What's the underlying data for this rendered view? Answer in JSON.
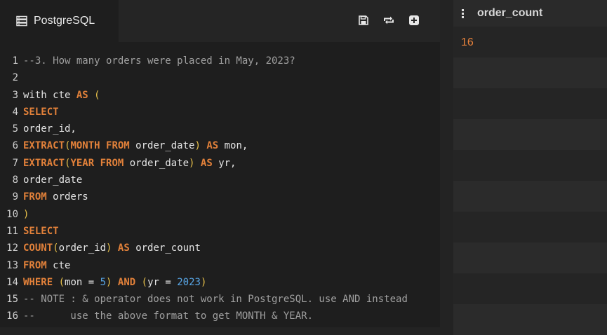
{
  "editor": {
    "tab_label": "PostgreSQL",
    "tab_icon": "database-icon",
    "toolbar": {
      "save_icon": "save-icon",
      "refresh_icon": "refresh-icon",
      "add_icon": "add-icon"
    },
    "lines": [
      {
        "num": "1",
        "tokens": [
          {
            "t": "--3. How many orders were placed in May, 2023?",
            "c": "c"
          }
        ]
      },
      {
        "num": "2",
        "tokens": []
      },
      {
        "num": "3",
        "tokens": [
          {
            "t": "with cte "
          },
          {
            "t": "AS",
            "c": "k"
          },
          {
            "t": " "
          },
          {
            "t": "(",
            "c": "p"
          }
        ]
      },
      {
        "num": "4",
        "tokens": [
          {
            "t": "SELECT",
            "c": "k"
          }
        ]
      },
      {
        "num": "5",
        "tokens": [
          {
            "t": "order_id,"
          }
        ]
      },
      {
        "num": "6",
        "tokens": [
          {
            "t": "EXTRACT",
            "c": "k"
          },
          {
            "t": "(",
            "c": "p"
          },
          {
            "t": "MONTH FROM",
            "c": "k"
          },
          {
            "t": " order_date"
          },
          {
            "t": ")",
            "c": "p"
          },
          {
            "t": " "
          },
          {
            "t": "AS",
            "c": "k"
          },
          {
            "t": " mon,"
          }
        ]
      },
      {
        "num": "7",
        "tokens": [
          {
            "t": "EXTRACT",
            "c": "k"
          },
          {
            "t": "(",
            "c": "p"
          },
          {
            "t": "YEAR FROM",
            "c": "k"
          },
          {
            "t": " order_date"
          },
          {
            "t": ")",
            "c": "p"
          },
          {
            "t": " "
          },
          {
            "t": "AS",
            "c": "k"
          },
          {
            "t": " yr,"
          }
        ]
      },
      {
        "num": "8",
        "tokens": [
          {
            "t": "order_date"
          }
        ]
      },
      {
        "num": "9",
        "tokens": [
          {
            "t": "FROM",
            "c": "k"
          },
          {
            "t": " orders"
          }
        ]
      },
      {
        "num": "10",
        "tokens": [
          {
            "t": ")",
            "c": "p"
          }
        ]
      },
      {
        "num": "11",
        "tokens": [
          {
            "t": "SELECT",
            "c": "k"
          }
        ]
      },
      {
        "num": "12",
        "tokens": [
          {
            "t": "COUNT",
            "c": "k"
          },
          {
            "t": "(",
            "c": "p"
          },
          {
            "t": "order_id"
          },
          {
            "t": ")",
            "c": "p"
          },
          {
            "t": " "
          },
          {
            "t": "AS",
            "c": "k"
          },
          {
            "t": " order_count"
          }
        ]
      },
      {
        "num": "13",
        "tokens": [
          {
            "t": "FROM",
            "c": "k"
          },
          {
            "t": " cte"
          }
        ]
      },
      {
        "num": "14",
        "tokens": [
          {
            "t": "WHERE",
            "c": "k"
          },
          {
            "t": " "
          },
          {
            "t": "(",
            "c": "p"
          },
          {
            "t": "mon = "
          },
          {
            "t": "5",
            "c": "n"
          },
          {
            "t": ")",
            "c": "p"
          },
          {
            "t": " "
          },
          {
            "t": "AND",
            "c": "k"
          },
          {
            "t": " "
          },
          {
            "t": "(",
            "c": "p"
          },
          {
            "t": "yr = "
          },
          {
            "t": "2023",
            "c": "n"
          },
          {
            "t": ")",
            "c": "p"
          }
        ]
      },
      {
        "num": "15",
        "tokens": [
          {
            "t": "-- NOTE : & operator does not work in PostgreSQL. use AND instead",
            "c": "c"
          }
        ]
      },
      {
        "num": "16",
        "tokens": [
          {
            "t": "--      use the above format to get MONTH & YEAR.",
            "c": "c"
          }
        ]
      }
    ]
  },
  "results": {
    "menu_icon": "kebab-menu-icon",
    "column": "order_count",
    "rows": [
      "16",
      "",
      "",
      "",
      "",
      "",
      "",
      "",
      "",
      ""
    ]
  },
  "colors": {
    "keyword": "#e2813a",
    "number": "#58a6e6",
    "paren": "#e8c14a",
    "comment": "#a0a0a0",
    "result_value": "#e8823c"
  }
}
